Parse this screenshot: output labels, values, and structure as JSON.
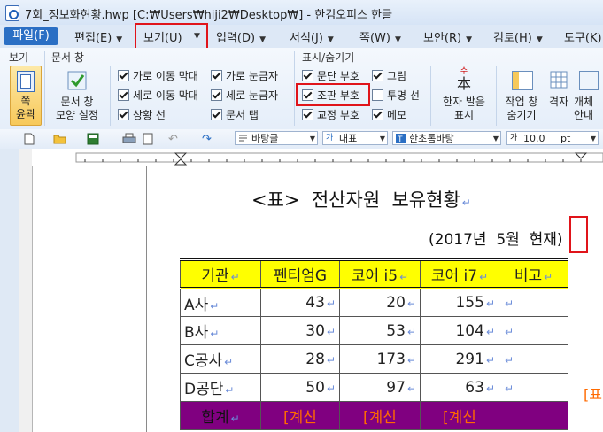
{
  "titlebar": {
    "title": "7회_정보화현황.hwp [C:₩Users₩hiji2₩Desktop₩] - 한컴오피스 한글"
  },
  "menubar": {
    "file": "파일(F)",
    "items": [
      "편집(E)",
      "보기(U)",
      "입력(D)",
      "서식(J)",
      "쪽(W)",
      "보안(R)",
      "검토(H)",
      "도구(K)"
    ]
  },
  "ribbon": {
    "group_view": "보기",
    "group_docwin": "문서 창",
    "group_display": "표시/숨기기",
    "page_outline": "쪽\n윤곽",
    "docwin_button": "문서 창\n모양 설정",
    "checks_col1": [
      {
        "label": "가로 이동 막대",
        "checked": true
      },
      {
        "label": "세로 이동 막대",
        "checked": true
      },
      {
        "label": "상황 선",
        "checked": true
      }
    ],
    "checks_col2": [
      {
        "label": "가로 눈금자",
        "checked": true
      },
      {
        "label": "세로 눈금자",
        "checked": true
      },
      {
        "label": "문서 탭",
        "checked": true
      }
    ],
    "checks_col3": [
      {
        "label": "문단 부호",
        "checked": true
      },
      {
        "label": "조판 부호",
        "checked": true
      },
      {
        "label": "교정 부호",
        "checked": true
      }
    ],
    "checks_col4": [
      {
        "label": "그림",
        "checked": true
      },
      {
        "label": "투명 선",
        "checked": false
      },
      {
        "label": "메모",
        "checked": true
      }
    ],
    "hanja_button": "한자 발음\n표시",
    "hanja_glyph": "本",
    "hanja_reading": "수",
    "workwin_button": "작업 창\n숨기기",
    "grid_button": "격자",
    "object_button": "개체\n안내"
  },
  "toolbar": {
    "style": "바탕글",
    "lang": "대표",
    "font": "한초롬바탕",
    "size": "10.0",
    "unit": "pt"
  },
  "document": {
    "title": "<표>  전산자원  보유현황",
    "subtitle": "(2017년  5월  현재)",
    "side_mark": "[표",
    "table": {
      "headers": [
        "기관",
        "펜티엄G",
        "코어 i5",
        "코어 i7",
        "비고"
      ],
      "rows": [
        [
          "A사",
          "43",
          "20",
          "155",
          ""
        ],
        [
          "B사",
          "30",
          "53",
          "104",
          ""
        ],
        [
          "C공사",
          "28",
          "173",
          "291",
          ""
        ],
        [
          "D공단",
          "50",
          "97",
          "63",
          ""
        ]
      ],
      "total": [
        "합계",
        "[계신",
        "[계신",
        "[계신",
        ""
      ]
    }
  },
  "colors": {
    "accent": "#2b6fc4",
    "highlight_box": "#e0141a",
    "header_bg": "#ffff00",
    "total_bg": "#800080",
    "total_text": "#ff6a00"
  }
}
